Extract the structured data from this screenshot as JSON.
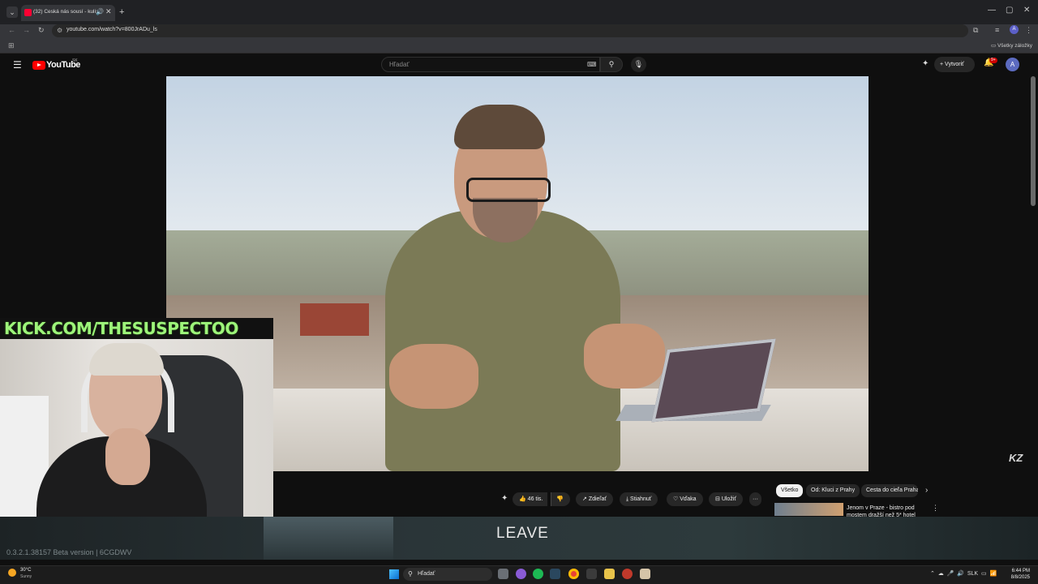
{
  "browser": {
    "tab_title": "(32) Česká nás sousí - kuliš",
    "tab_sound_icon": "speaker-icon",
    "url": "youtube.com/watch?v=800JrADu_ls",
    "bookmarks_label": "Všetky záložky",
    "profile_initial": "A"
  },
  "youtube": {
    "logo_text": "YouTube",
    "logo_region": "SK",
    "search_placeholder": "Hľadať",
    "create_label": "Vytvoriť",
    "notifications_badge": "9+",
    "avatar_initial": "A",
    "watermark": "KZ"
  },
  "overlay": {
    "kick_text": "KICK.COM/THESUSPECTOO"
  },
  "actions": {
    "likes": "46 tis.",
    "share": "Zdieľať",
    "download": "Stiahnuť",
    "thanks": "Vďaka",
    "save": "Uložiť",
    "more": "···"
  },
  "chips": [
    "Všetko",
    "Od: Kluci z Prahy",
    "Cesta do cieľa Praha"
  ],
  "recommendation": {
    "title": "Jenom v Praze - bistro pod mostem dražší než 5* hotel"
  },
  "game": {
    "leave_label": "LEAVE",
    "version_text": "0.3.2.1.38157 Beta version | 6CGDWV"
  },
  "taskbar": {
    "temperature": "30°C",
    "weather": "Sunny",
    "search_label": "Hľadať",
    "language": "SLK",
    "time": "6:44 PM",
    "date": "8/8/2025"
  },
  "colors": {
    "youtube_red": "#ff0000",
    "kick_green": "#9df57a",
    "background": "#0f0f0f"
  }
}
